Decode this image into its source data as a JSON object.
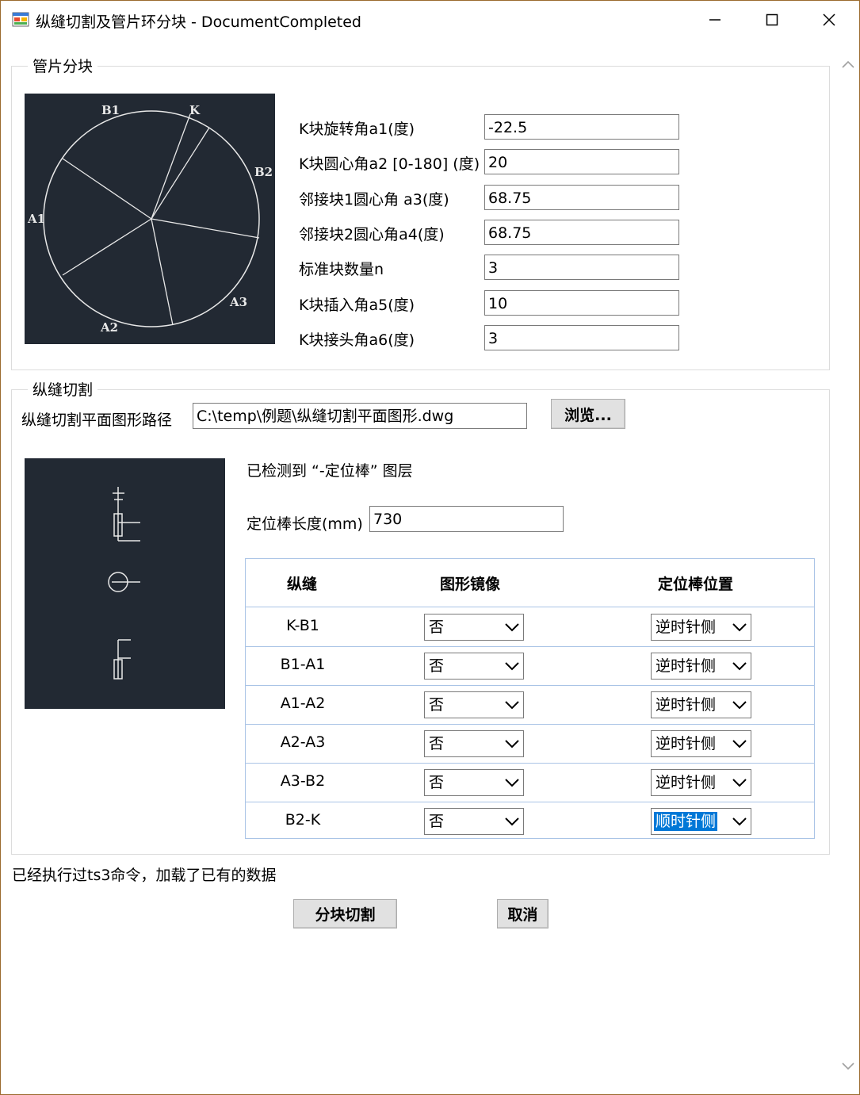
{
  "window": {
    "title": "纵缝切割及管片环分块 - DocumentCompleted"
  },
  "segment_group": {
    "title": "管片分块",
    "diagram_labels": [
      "B1",
      "K",
      "B2",
      "A1",
      "A3",
      "A2"
    ],
    "fields": [
      {
        "label": "K块旋转角a1(度)",
        "value": "-22.5"
      },
      {
        "label": "K块圆心角a2 [0-180] (度)",
        "value": "20"
      },
      {
        "label": "邻接块1圆心角  a3(度)",
        "value": "68.75"
      },
      {
        "label": "邻接块2圆心角a4(度)",
        "value": "68.75"
      },
      {
        "label": "标准块数量n",
        "value": "3"
      },
      {
        "label": "K块插入角a5(度)",
        "value": "10"
      },
      {
        "label": "K块接头角a6(度)",
        "value": "3"
      }
    ]
  },
  "cut_group": {
    "title": "纵缝切割",
    "path_label": "纵缝切割平面图形路径",
    "path_value": "C:\\temp\\例题\\纵缝切割平面图形.dwg",
    "browse_label": "浏览...",
    "detected_text": "已检测到 “-定位棒” 图层",
    "rod_length_label": "定位棒长度(mm)",
    "rod_length_value": "730",
    "table": {
      "headers": [
        "纵缝",
        "图形镜像",
        "定位棒位置"
      ],
      "rows": [
        {
          "seam": "K-B1",
          "mirror": "否",
          "position": "逆时针侧"
        },
        {
          "seam": "B1-A1",
          "mirror": "否",
          "position": "逆时针侧"
        },
        {
          "seam": "A1-A2",
          "mirror": "否",
          "position": "逆时针侧"
        },
        {
          "seam": "A2-A3",
          "mirror": "否",
          "position": "逆时针侧"
        },
        {
          "seam": "A3-B2",
          "mirror": "否",
          "position": "逆时针侧"
        },
        {
          "seam": "B2-K",
          "mirror": "否",
          "position": "顺时针侧"
        }
      ]
    }
  },
  "status_text": "已经执行过ts3命令，加载了已有的数据",
  "actions": {
    "split_cut_label": "分块切割",
    "cancel_label": "取消"
  },
  "colors": {
    "panel_bg": "#222933",
    "selection": "#0078d7",
    "window_border": "#9a6a2e",
    "grid_border": "#aac4e6"
  }
}
